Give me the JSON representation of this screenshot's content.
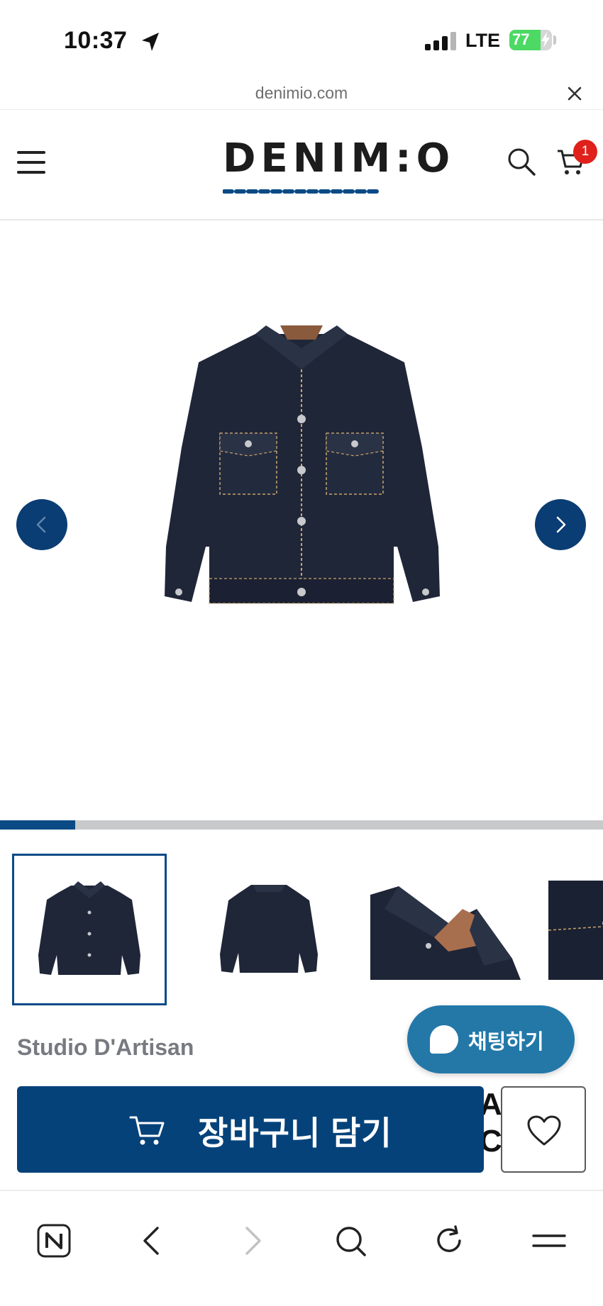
{
  "status_bar": {
    "time": "10:37",
    "network": "LTE",
    "battery_level": "77",
    "icons": [
      "location-arrow-icon",
      "signal-bars-icon",
      "battery-charging-icon"
    ]
  },
  "browser": {
    "url": "denimio.com",
    "close_icon": "close-icon"
  },
  "header": {
    "logo_text": "DENIM:O",
    "menu_icon": "hamburger-icon",
    "search_icon": "search-icon",
    "cart_icon": "cart-icon",
    "cart_count": "1",
    "colors": {
      "brand_blue": "#0a4a85",
      "badge_red": "#e0201b"
    }
  },
  "gallery": {
    "prev_icon": "chevron-left-icon",
    "next_icon": "chevron-right-icon",
    "progress": 0.125,
    "image_count_visible": 4
  },
  "product": {
    "brand": "Studio D'Artisan",
    "title_fragment": "A\nC"
  },
  "chat": {
    "label": "채팅하기",
    "icon": "chat-bubble-icon",
    "color": "#2378a8"
  },
  "actions": {
    "add_to_cart_label": "장바구니 담기",
    "add_to_cart_icon": "cart-icon",
    "wishlist_icon": "heart-icon",
    "primary_color": "#05427a"
  },
  "toolbar": {
    "items": [
      "naver-home-icon",
      "back-icon",
      "forward-icon",
      "search-icon",
      "reload-icon",
      "menu-icon"
    ]
  }
}
